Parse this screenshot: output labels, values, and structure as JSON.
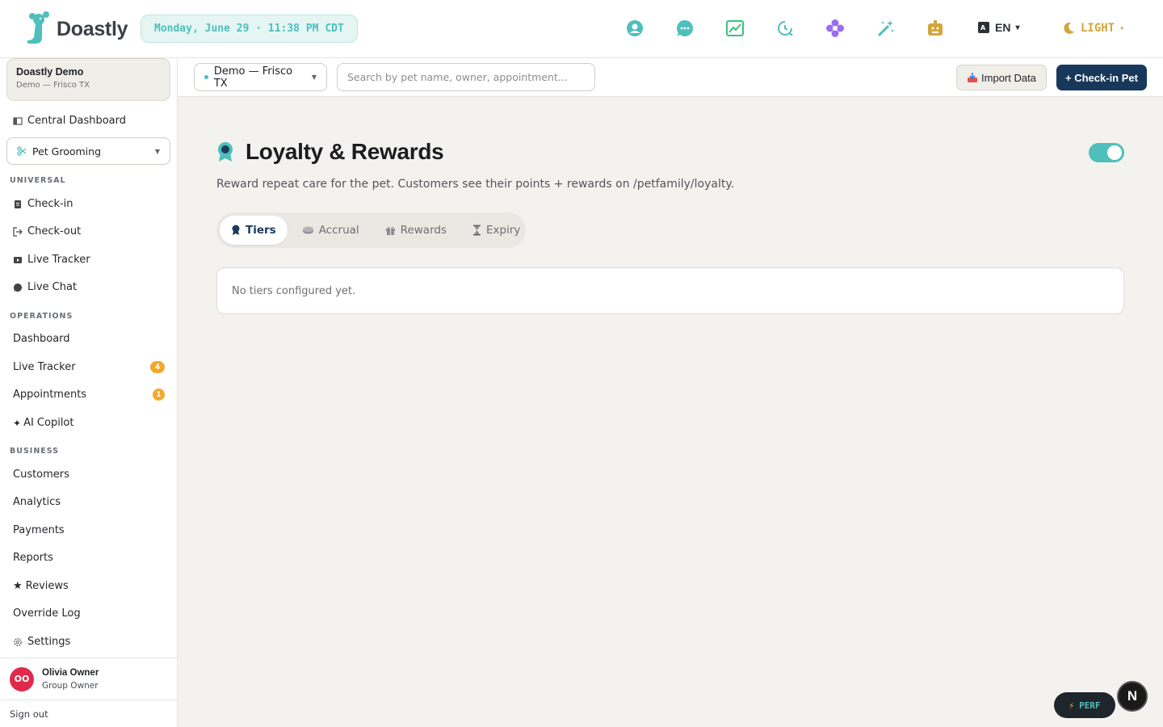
{
  "app": {
    "name": "Doastly",
    "datetime": "Monday, June 29 · 11:38 PM CDT"
  },
  "topbar": {
    "icons": [
      "user-circle-icon",
      "chat-bubble-icon",
      "chart-image-icon",
      "clock-history-icon",
      "flower-icon",
      "magic-wand-icon",
      "robot-icon"
    ],
    "language": "EN",
    "theme": "LIGHT"
  },
  "sidebar": {
    "org": {
      "name": "Doastly Demo",
      "location": "Demo — Frisco TX"
    },
    "central_dashboard": "Central Dashboard",
    "module": "Pet Grooming",
    "sections": {
      "universal": "UNIVERSAL",
      "operations": "OPERATIONS",
      "business": "BUSINESS"
    },
    "universal_items": [
      "Check-in",
      "Check-out",
      "Live Tracker",
      "Live Chat"
    ],
    "operations_items": [
      {
        "label": "Dashboard",
        "badge": null
      },
      {
        "label": "Live Tracker",
        "badge": "4"
      },
      {
        "label": "Appointments",
        "badge": "1"
      },
      {
        "label": "AI Copilot",
        "badge": null
      }
    ],
    "business_items": [
      "Customers",
      "Analytics",
      "Payments",
      "Reports",
      "Reviews",
      "Override Log",
      "Settings"
    ],
    "user": {
      "initials": "OO",
      "name": "Olivia Owner",
      "role": "Group Owner"
    },
    "signout": "Sign out"
  },
  "subbar": {
    "location": "Demo — Frisco TX",
    "search_placeholder": "Search by pet name, owner, appointment...",
    "import_label": "Import Data",
    "checkin_label": "+ Check-in Pet"
  },
  "page": {
    "title": "Loyalty & Rewards",
    "enabled": true,
    "subtitle": "Reward repeat care for the pet. Customers see their points + rewards on /petfamily/loyalty.",
    "tabs": [
      "Tiers",
      "Accrual",
      "Rewards",
      "Expiry"
    ],
    "active_tab": "Tiers",
    "empty_message": "No tiers configured yet."
  },
  "dev": {
    "perf_label": "PERF",
    "n_label": "N"
  },
  "colors": {
    "accent": "#4fbfbb",
    "navy": "#17385a",
    "badge": "#f3a82b",
    "avatar": "#e02a4c",
    "theme": "#d3a63b"
  }
}
